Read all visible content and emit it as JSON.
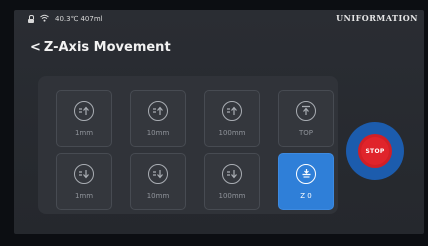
{
  "status": {
    "temperature": "40.3℃",
    "volume": "407ml",
    "brand": "UNIFORMATION"
  },
  "page": {
    "title": "Z-Axis Movement",
    "back_glyph": "<"
  },
  "tiles": [
    {
      "label": "1mm",
      "icon": "move-up-icon"
    },
    {
      "label": "10mm",
      "icon": "move-up-icon"
    },
    {
      "label": "100mm",
      "icon": "move-up-icon"
    },
    {
      "label": "TOP",
      "icon": "go-top-icon"
    },
    {
      "label": "1mm",
      "icon": "move-down-icon"
    },
    {
      "label": "10mm",
      "icon": "move-down-icon"
    },
    {
      "label": "100mm",
      "icon": "move-down-icon"
    },
    {
      "label": "Z 0",
      "icon": "home-z-icon",
      "active": true
    }
  ],
  "stop": {
    "label": "STOP"
  },
  "colors": {
    "accent": "#2f7fd8",
    "stop_red": "#e0242b",
    "stop_ring": "#1c5cad",
    "background": "#2a2d33"
  }
}
